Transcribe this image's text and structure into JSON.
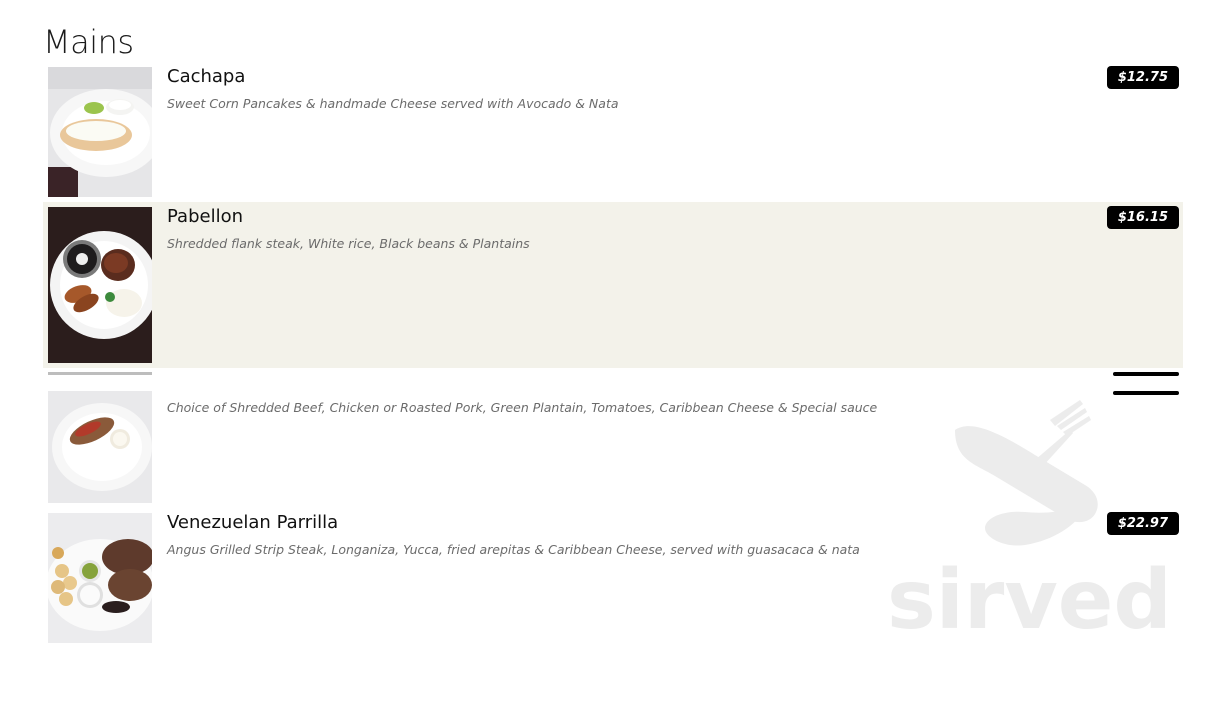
{
  "section": {
    "title": "Mains"
  },
  "items": [
    {
      "name": "Cachapa",
      "description": "Sweet Corn Pancakes & handmade Cheese served with Avocado & Nata",
      "price": "$12.75"
    },
    {
      "name": "Pabellon",
      "description": "Shredded flank steak, White rice, Black beans & Plantains",
      "price": "$16.15"
    },
    {
      "name": "",
      "description": "Choice of Shredded Beef, Chicken or Roasted Pork, Green Plantain, Tomatoes, Caribbean Cheese & Special sauce",
      "price": ""
    },
    {
      "name": "Venezuelan Parrilla",
      "description": "Angus Grilled Strip Steak, Longaniza, Yucca, fried arepitas & Caribbean Cheese, served with guasacaca & nata",
      "price": "$22.97"
    }
  ],
  "watermark": {
    "text": "sirved",
    "icon": "fork-spoon-icon"
  },
  "colors": {
    "highlight_row": "#f3f2ea",
    "price_badge": "#000000",
    "price_text": "#ffffff",
    "description": "#6b6b6b",
    "watermark": "#ececec"
  }
}
